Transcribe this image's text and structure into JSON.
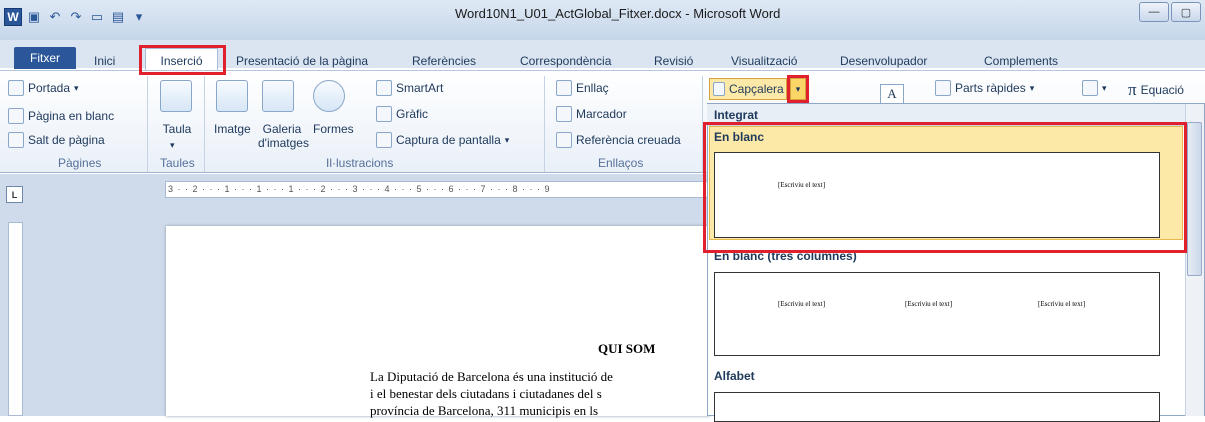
{
  "window": {
    "title": "Word10N1_U01_ActGlobal_Fitxer.docx - Microsoft Word"
  },
  "tabs": {
    "file": "Fitxer",
    "home": "Inici",
    "insert": "Inserció",
    "layout": "Presentació de la pàgina",
    "references": "Referències",
    "mailings": "Correspondència",
    "review": "Revisió",
    "view": "Visualització",
    "developer": "Desenvolupador",
    "addins": "Complements"
  },
  "ribbon": {
    "pages": {
      "cover": "Portada",
      "blank": "Pàgina en blanc",
      "break": "Salt de pàgina",
      "group": "Pàgines"
    },
    "tables": {
      "table": "Taula",
      "group": "Taules"
    },
    "illustrations": {
      "image": "Imatge",
      "clipart": "Galeria d'imatges",
      "shapes": "Formes",
      "smartart": "SmartArt",
      "chart": "Gràfic",
      "screenshot": "Captura de pantalla",
      "group": "Il·lustracions"
    },
    "links": {
      "hyperlink": "Enllaç",
      "bookmark": "Marcador",
      "crossref": "Referència creuada",
      "group": "Enllaços"
    },
    "header": "Capçalera",
    "quickparts": "Parts ràpides",
    "equation": "Equació"
  },
  "ruler": {
    "marks": "3 · · 2 · · · 1 · · · 1 · · · 1 · · · 2 · · · 3 · · · 4 · · · 5 · · · 6 · · · 7 · · · 8 · · · 9"
  },
  "document": {
    "heading": "QUI SOM",
    "lines": [
      "La Diputació de Barcelona és una institució de",
      "i el benestar dels ciutadans i ciutadanes del s",
      "província de Barcelona, 311 municipis en ls"
    ]
  },
  "gallery": {
    "header": "Integrat",
    "items": [
      {
        "label": "En blanc",
        "placeholders": [
          "[Escriviu el text]"
        ]
      },
      {
        "label": "En blanc (tres columnes)",
        "placeholders": [
          "[Escriviu el text]",
          "[Escriviu el text]",
          "[Escriviu el text]"
        ]
      },
      {
        "label": "Alfabet",
        "placeholders": []
      }
    ]
  },
  "colors": {
    "highlight_box": "#e0202c",
    "selected_item": "#fde9a7",
    "file_tab": "#2b579a"
  }
}
